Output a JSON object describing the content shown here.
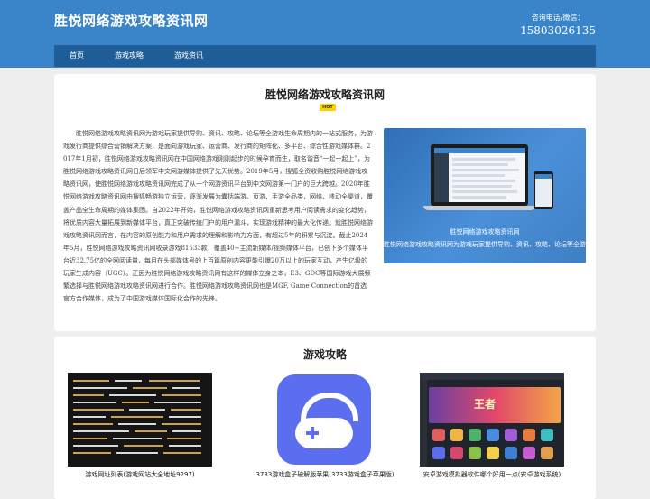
{
  "header": {
    "site_title": "胜悦网络游戏攻略资讯网",
    "contact_label": "咨询电话/微信：",
    "contact_phone": "15803026135"
  },
  "nav": {
    "items": [
      {
        "label": "首页"
      },
      {
        "label": "游戏攻略"
      },
      {
        "label": "游戏资讯"
      }
    ]
  },
  "intro": {
    "title": "胜悦网络游戏攻略资讯网",
    "badge": "HOT",
    "text": "胜悦网络游戏攻略资讯网为游戏玩家提供导购、资讯、攻略、论坛等全游戏生命周期内的一站式服务，为游戏发行商提供综合营销解决方案，是面向游戏玩家、运营商、发行商的矩阵化、多平台、综合性游戏媒体群。2017年1月初，胜悦网络游戏攻略资讯网在中国网络游戏刚刚起步的时候孕育而生，取名谐音“一起一起上”，为胜悦网络游戏攻略资讯网日后领军中文网游媒体提供了先天优势。2019年5月，搜狐全资收购胜悦网络游戏攻略资讯网，使胜悦网络游戏攻略资讯网完成了从一个网游资讯平台到中文网游第一门户的巨大跨越。2020年胜悦网络游戏攻略资讯网由搜狐畅游独立运营，逐渐发展为囊括端游、页游、手游全品类，网络、移动全渠道，覆盖产品全生命周期的媒体集团。自2022年开始，胜悦网络游戏攻略资讯网重新思考用户阅读需求的变化趋势，将优质内容大量拓展到新媒体平台，真正突破传统门户的用户漏斗，实现游戏精神的最大化传递。就胜悦网络游戏攻略资讯网而言，在内容的原创能力和用户需求的理解和影响力方面，有超过5年的积累与沉淀。截止2024年5月，胜悦网络游戏攻略资讯网收录游戏81533款，覆盖40+主流新媒体/视频媒体平台，已创下多个媒体平台近32.75亿的全网阅读量，每月在头部媒体号的上百篇原创内容更能引爆20万以上的玩家互动，产生亿级的玩家生成内容（UGC）。正因为胜悦网络游戏攻略资讯网有这样的媒体立身之本，E3、GDC等国际游戏大展频繁选择与胜悦网络游戏攻略资讯网进行合作。胜悦网络游戏攻略资讯网也是MGF, Game Connection的首选官方合作媒体，成为了中国游戏媒体国际化合作的先锋。",
    "image_caption_title": "胜悦网络游戏攻略资讯网",
    "image_caption_desc": "胜悦网络游戏攻略资讯网为游戏玩家提供导购、资讯、攻略、论坛等全游戏生命周期内的一站式服务，为游戏发行商提供综合营销解决方案"
  },
  "guides": {
    "title": "游戏攻略",
    "items": [
      {
        "title": "游戏网址列表(游戏网站大全地址9297)",
        "thumb": "dark-list-screenshot"
      },
      {
        "title": "3733游戏盒子破解版苹果(3733游戏盒子苹果版)",
        "thumb": "gamepad-app-icon"
      },
      {
        "title": "安卓游戏模拟器软件哪个好用一点(安卓游戏系统)",
        "thumb": "emulator-screenshot"
      }
    ]
  },
  "colors": {
    "header_bg": "#3a84c9",
    "nav_bg": "#1f5d99",
    "badge": "#f5d400"
  }
}
